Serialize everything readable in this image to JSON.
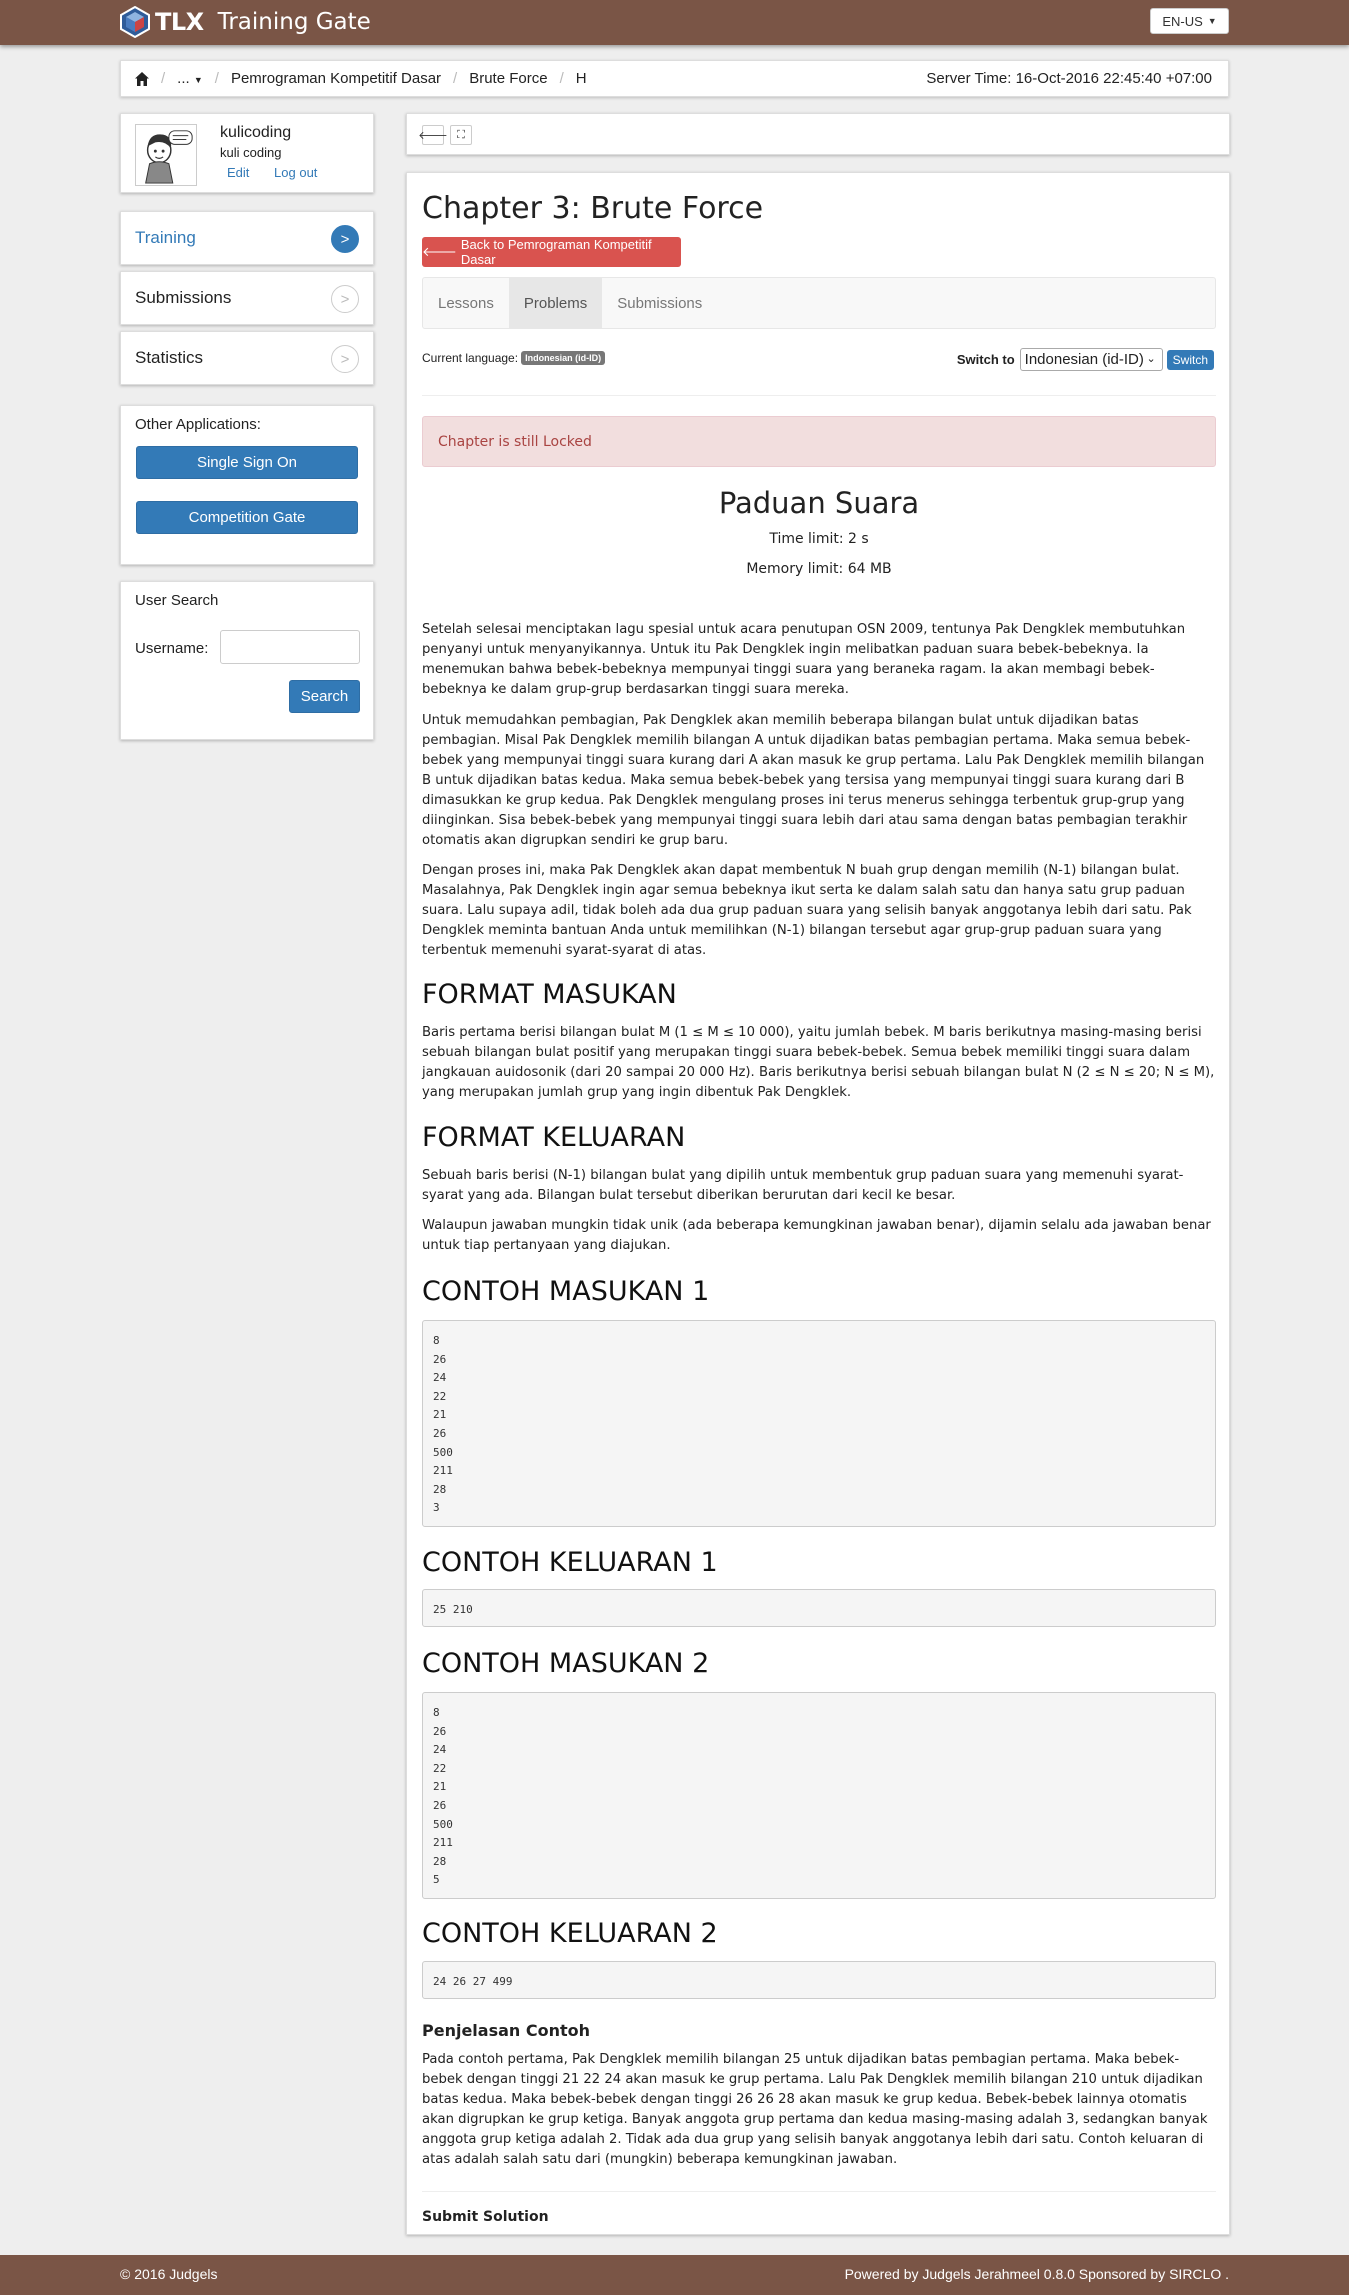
{
  "header": {
    "logo_text": "TLX",
    "app_title": "Training Gate",
    "language_button": "EN-US"
  },
  "breadcrumb": {
    "ellipsis": "...",
    "items": [
      "Pemrograman Kompetitif Dasar",
      "Brute Force",
      "H"
    ],
    "server_time": "Server Time: 16-Oct-2016 22:45:40 +07:00"
  },
  "profile": {
    "username": "kulicoding",
    "fullname": "kuli coding",
    "edit_link": "Edit",
    "logout_link": "Log out"
  },
  "sidebar": {
    "nav": [
      {
        "label": "Training",
        "active": true,
        "arrow": ">"
      },
      {
        "label": "Submissions",
        "active": false,
        "arrow": ">"
      },
      {
        "label": "Statistics",
        "active": false,
        "arrow": ">"
      }
    ],
    "other_apps": {
      "label": "Other Applications:",
      "buttons": [
        "Single Sign On",
        "Competition Gate"
      ]
    },
    "user_search": {
      "title": "User Search",
      "username_label": "Username:",
      "search_button": "Search"
    }
  },
  "chapter": {
    "title": "Chapter 3: Brute Force",
    "back_button": "Back to Pemrograman Kompetitif Dasar",
    "tabs": [
      {
        "label": "Lessons",
        "active": false
      },
      {
        "label": "Problems",
        "active": true
      },
      {
        "label": "Submissions",
        "active": false
      }
    ],
    "current_language_label": "Current language:",
    "current_language": "Indonesian (id-ID)",
    "switch_label": "Switch to",
    "switch_selected": "Indonesian (id-ID)",
    "switch_button": "Switch",
    "locked_alert": "Chapter is still Locked"
  },
  "problem": {
    "title": "Paduan Suara",
    "time_limit": "Time limit: 2 s",
    "memory_limit": "Memory limit: 64 MB",
    "paragraphs": [
      "Setelah selesai menciptakan lagu spesial untuk acara penutupan OSN 2009, tentunya Pak Dengklek membutuhkan penyanyi untuk menyanyikannya. Untuk itu Pak Dengklek ingin melibatkan paduan suara bebek-bebeknya. Ia menemukan bahwa bebek-bebeknya mempunyai tinggi suara yang beraneka ragam. Ia akan membagi bebek-bebeknya ke dalam grup-grup berdasarkan tinggi suara mereka.",
      "Untuk memudahkan pembagian, Pak Dengklek akan memilih beberapa bilangan bulat untuk dijadikan batas pembagian. Misal Pak Dengklek memilih bilangan A untuk dijadikan batas pembagian pertama. Maka semua bebek-bebek yang mempunyai tinggi suara kurang dari A akan masuk ke grup pertama. Lalu Pak Dengklek memilih bilangan B untuk dijadikan batas kedua. Maka semua bebek-bebek yang tersisa yang mempunyai tinggi suara kurang dari B dimasukkan ke grup kedua. Pak Dengklek mengulang proses ini terus menerus sehingga terbentuk grup-grup yang diinginkan. Sisa bebek-bebek yang mempunyai tinggi suara lebih dari atau sama dengan batas pembagian terakhir otomatis akan digrupkan sendiri ke grup baru.",
      "Dengan proses ini, maka Pak Dengklek akan dapat membentuk N buah grup dengan memilih (N-1) bilangan bulat. Masalahnya, Pak Dengklek ingin agar semua bebeknya ikut serta ke dalam salah satu dan hanya satu grup paduan suara. Lalu supaya adil, tidak boleh ada dua grup paduan suara yang selisih banyak anggotanya lebih dari satu. Pak Dengklek meminta bantuan Anda untuk memilihkan (N-1) bilangan tersebut agar grup-grup paduan suara yang terbentuk memenuhi syarat-syarat di atas."
    ],
    "input_format_heading": "FORMAT MASUKAN",
    "input_format": "Baris pertama berisi bilangan bulat M (1 ≤ M ≤ 10 000), yaitu jumlah bebek. M baris berikutnya masing-masing berisi sebuah bilangan bulat positif yang merupakan tinggi suara bebek-bebek. Semua bebek memiliki tinggi suara dalam jangkauan auidosonik (dari 20 sampai 20 000 Hz). Baris berikutnya berisi sebuah bilangan bulat N (2 ≤ N ≤ 20; N ≤ M), yang merupakan jumlah grup yang ingin dibentuk Pak Dengklek.",
    "output_format_heading": "FORMAT KELUARAN",
    "output_format_1": "Sebuah baris berisi (N-1) bilangan bulat yang dipilih untuk membentuk grup paduan suara yang memenuhi syarat-syarat yang ada. Bilangan bulat tersebut diberikan berurutan dari kecil ke besar.",
    "output_format_2": "Walaupun jawaban mungkin tidak unik (ada beberapa kemungkinan jawaban benar), dijamin selalu ada jawaban benar untuk tiap pertanyaan yang diajukan.",
    "sample_input_1_heading": "CONTOH MASUKAN 1",
    "sample_input_1": "8\n26\n24\n22\n21\n26\n500\n211\n28\n3",
    "sample_output_1_heading": "CONTOH KELUARAN 1",
    "sample_output_1": "25 210",
    "sample_input_2_heading": "CONTOH MASUKAN 2",
    "sample_input_2": "8\n26\n24\n22\n21\n26\n500\n211\n28\n5",
    "sample_output_2_heading": "CONTOH KELUARAN 2",
    "sample_output_2": "24 26 27 499",
    "explanation_heading": "Penjelasan Contoh",
    "explanation": "Pada contoh pertama, Pak Dengklek memilih bilangan 25 untuk dijadikan batas pembagian pertama. Maka bebek-bebek dengan tinggi 21 22 24 akan masuk ke grup pertama. Lalu Pak Dengklek memilih bilangan 210 untuk dijadikan batas kedua. Maka bebek-bebek dengan tinggi 26 26 28 akan masuk ke grup kedua. Bebek-bebek lainnya otomatis akan digrupkan ke grup ketiga. Banyak anggota grup pertama dan kedua masing-masing adalah 3, sedangkan banyak anggota grup ketiga adalah 2. Tidak ada dua grup yang selisih banyak anggotanya lebih dari satu. Contoh keluaran di atas adalah salah satu dari (mungkin) beberapa kemungkinan jawaban.",
    "submit_heading": "Submit Solution"
  },
  "footer": {
    "copyright": "© 2016 Judgels",
    "powered": "Powered by Judgels Jerahmeel 0.8.0 Sponsored by SIRCLO ."
  },
  "colors": {
    "header_brown": "#7a5546",
    "primary_blue": "#337ab7",
    "danger_red": "#d9534f"
  }
}
